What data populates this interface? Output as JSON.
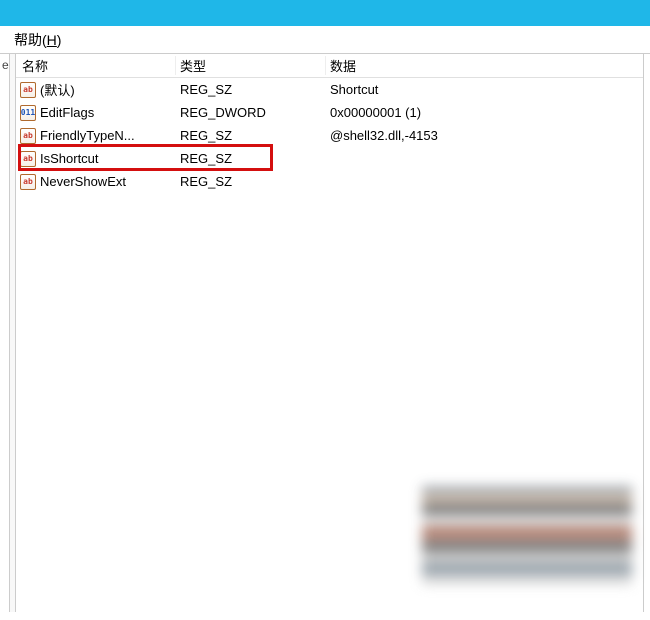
{
  "menu": {
    "help_label": "帮助",
    "help_accel": "H"
  },
  "left_fragment": "e",
  "columns": {
    "name": "名称",
    "type": "类型",
    "data": "数据"
  },
  "rows": [
    {
      "icon": "str",
      "name": "(默认)",
      "type": "REG_SZ",
      "data": "Shortcut"
    },
    {
      "icon": "bin",
      "name": "EditFlags",
      "type": "REG_DWORD",
      "data": "0x00000001 (1)"
    },
    {
      "icon": "str",
      "name": "FriendlyTypeN...",
      "type": "REG_SZ",
      "data": "@shell32.dll,-4153"
    },
    {
      "icon": "str",
      "name": "IsShortcut",
      "type": "REG_SZ",
      "data": ""
    },
    {
      "icon": "str",
      "name": "NeverShowExt",
      "type": "REG_SZ",
      "data": ""
    }
  ],
  "highlight_row_index": 3,
  "icon_glyph": {
    "str": "ab",
    "bin": "011"
  }
}
